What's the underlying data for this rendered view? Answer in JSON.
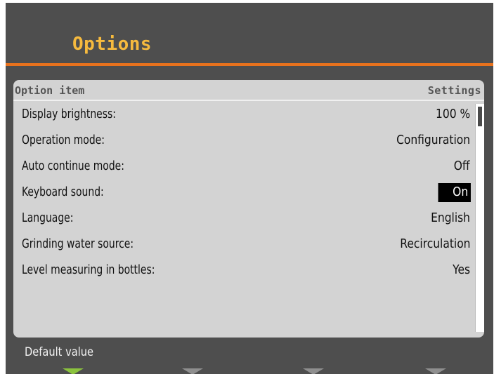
{
  "title": "Options",
  "header": {
    "left": "Option item",
    "right": "Settings"
  },
  "options": [
    {
      "label": "Display brightness:",
      "value": "100 %"
    },
    {
      "label": "Operation mode:",
      "value": "Configuration"
    },
    {
      "label": "Auto continue mode:",
      "value": "Off"
    },
    {
      "label": "Keyboard sound:",
      "value": "On"
    },
    {
      "label": "Language:",
      "value": "English"
    },
    {
      "label": "Grinding water source:",
      "value": "Recirculation"
    },
    {
      "label": "Level measuring in bottles:",
      "value": "Yes"
    }
  ],
  "footer": {
    "label": "Default value"
  },
  "colors": {
    "title": "#f6ba3e",
    "accent_line": "#e8721d",
    "softkey_active": "#8bc23e",
    "softkey_inactive": "#8f8f8f"
  },
  "softkeys": [
    "green-arrow-icon",
    "gray-arrow-icon",
    "gray-arrow-icon",
    "gray-arrow-icon"
  ]
}
